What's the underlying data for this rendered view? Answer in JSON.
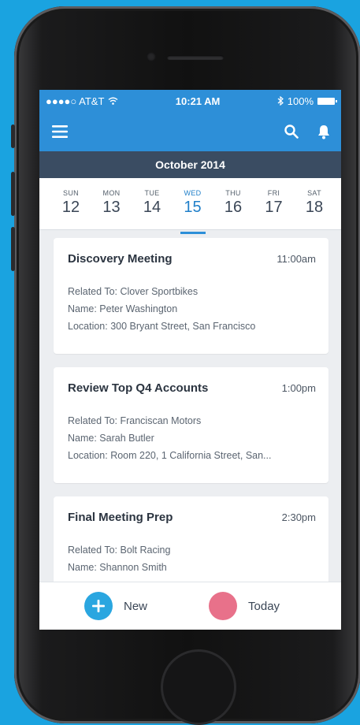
{
  "status_bar": {
    "carrier": "●●●●○ AT&T",
    "time": "10:21 AM",
    "battery": "100%"
  },
  "nav": {
    "icons": [
      "menu-icon",
      "search-icon",
      "bell-icon"
    ]
  },
  "month_label": "October 2014",
  "week": [
    {
      "dow": "SUN",
      "num": "12"
    },
    {
      "dow": "MON",
      "num": "13"
    },
    {
      "dow": "TUE",
      "num": "14"
    },
    {
      "dow": "WED",
      "num": "15"
    },
    {
      "dow": "THU",
      "num": "16"
    },
    {
      "dow": "FRI",
      "num": "17"
    },
    {
      "dow": "SAT",
      "num": "18"
    }
  ],
  "events": [
    {
      "title": "Discovery Meeting",
      "time": "11:00am",
      "related": "Related To: Clover Sportbikes",
      "name": "Name: Peter Washington",
      "location": "Location: 300 Bryant Street, San Francisco"
    },
    {
      "title": "Review Top Q4 Accounts",
      "time": "1:00pm",
      "related": "Related To: Franciscan Motors",
      "name": "Name: Sarah Butler",
      "location": "Location: Room 220, 1 California Street, San..."
    },
    {
      "title": "Final Meeting Prep",
      "time": "2:30pm",
      "related": "Related To: Bolt Racing",
      "name": "Name: Shannon Smith",
      "location": ""
    }
  ],
  "bottom": {
    "new_label": "New",
    "today_label": "Today"
  },
  "colors": {
    "background": "#1aa3e0",
    "header_blue": "#2d8fd8",
    "month_bar": "#3a4c62",
    "new_button": "#2aa6e0",
    "today_button": "#e8718a"
  }
}
